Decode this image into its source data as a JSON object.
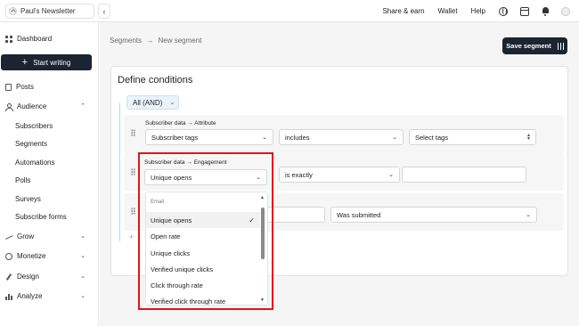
{
  "topbar": {
    "publication_name": "Paul's Newsletter",
    "links": [
      "Share & earn",
      "Wallet",
      "Help"
    ],
    "icons": [
      "globe-icon",
      "calendar-icon",
      "bell-icon",
      "avatar-icon"
    ]
  },
  "sidebar": {
    "dashboard": "Dashboard",
    "start_writing": "Start writing",
    "posts": "Posts",
    "audience": "Audience",
    "audience_items": [
      "Subscribers",
      "Segments",
      "Automations",
      "Polls",
      "Surveys",
      "Subscribe forms"
    ],
    "grow": "Grow",
    "monetize": "Monetize",
    "design": "Design",
    "analyze": "Analyze"
  },
  "breadcrumb": {
    "parent": "Segments",
    "separator": "→",
    "current": "New segment"
  },
  "save_button": "Save segment",
  "define": {
    "title": "Define conditions",
    "group_operator": "All (AND)"
  },
  "conditions": [
    {
      "category": "Subscriber data",
      "arrow": "→",
      "type": "Attribute",
      "field": "Subscriber tags",
      "operator": "includes",
      "value_placeholder": "Select tags"
    },
    {
      "category": "Subscriber data",
      "arrow": "→",
      "type": "Engagement",
      "field": "Unique opens",
      "operator": "is exactly",
      "value": ""
    },
    {
      "operator": "Was submitted"
    }
  ],
  "dropdown": {
    "group_header": "Email",
    "items": [
      "Unique opens",
      "Open rate",
      "Unique clicks",
      "Verified unique clicks",
      "Click through rate",
      "Verified click through rate"
    ],
    "selected_index": 0
  },
  "colors": {
    "primary_dark": "#1b2430",
    "highlight_red": "#e0141e",
    "chip_bg": "#eaf2fa"
  }
}
